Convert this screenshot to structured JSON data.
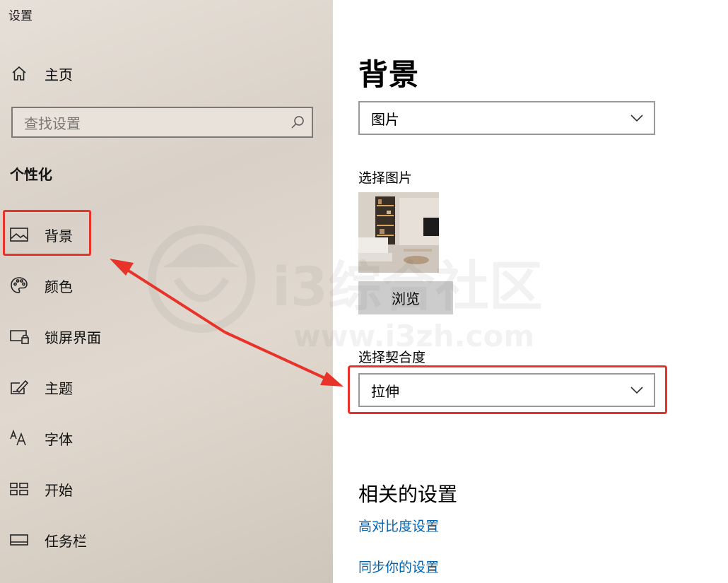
{
  "app": {
    "title": "设置"
  },
  "sidebar": {
    "home_label": "主页",
    "search": {
      "placeholder": "查找设置"
    },
    "section_title": "个性化",
    "items": [
      {
        "label": "背景",
        "icon": "image-icon",
        "selected": true
      },
      {
        "label": "颜色",
        "icon": "palette-icon"
      },
      {
        "label": "锁屏界面",
        "icon": "lock-screen-icon"
      },
      {
        "label": "主题",
        "icon": "theme-brush-icon"
      },
      {
        "label": "字体",
        "icon": "font-icon"
      },
      {
        "label": "开始",
        "icon": "start-grid-icon"
      },
      {
        "label": "任务栏",
        "icon": "taskbar-icon"
      }
    ]
  },
  "main": {
    "title": "背景",
    "background_dropdown": {
      "value": "图片"
    },
    "choose_picture_label": "选择图片",
    "browse_label": "浏览",
    "fit_label": "选择契合度",
    "fit_dropdown": {
      "value": "拉伸"
    },
    "related_title": "相关的设置",
    "links": [
      "高对比度设置",
      "同步你的设置"
    ]
  },
  "watermark": {
    "text": "i3综合社区",
    "url_text": "www.i3zh.com"
  },
  "colors": {
    "highlight": "#e8332a",
    "link": "#0063b1",
    "sidebar_bg": "#dcd4ca",
    "button_bg": "#cccccc"
  }
}
